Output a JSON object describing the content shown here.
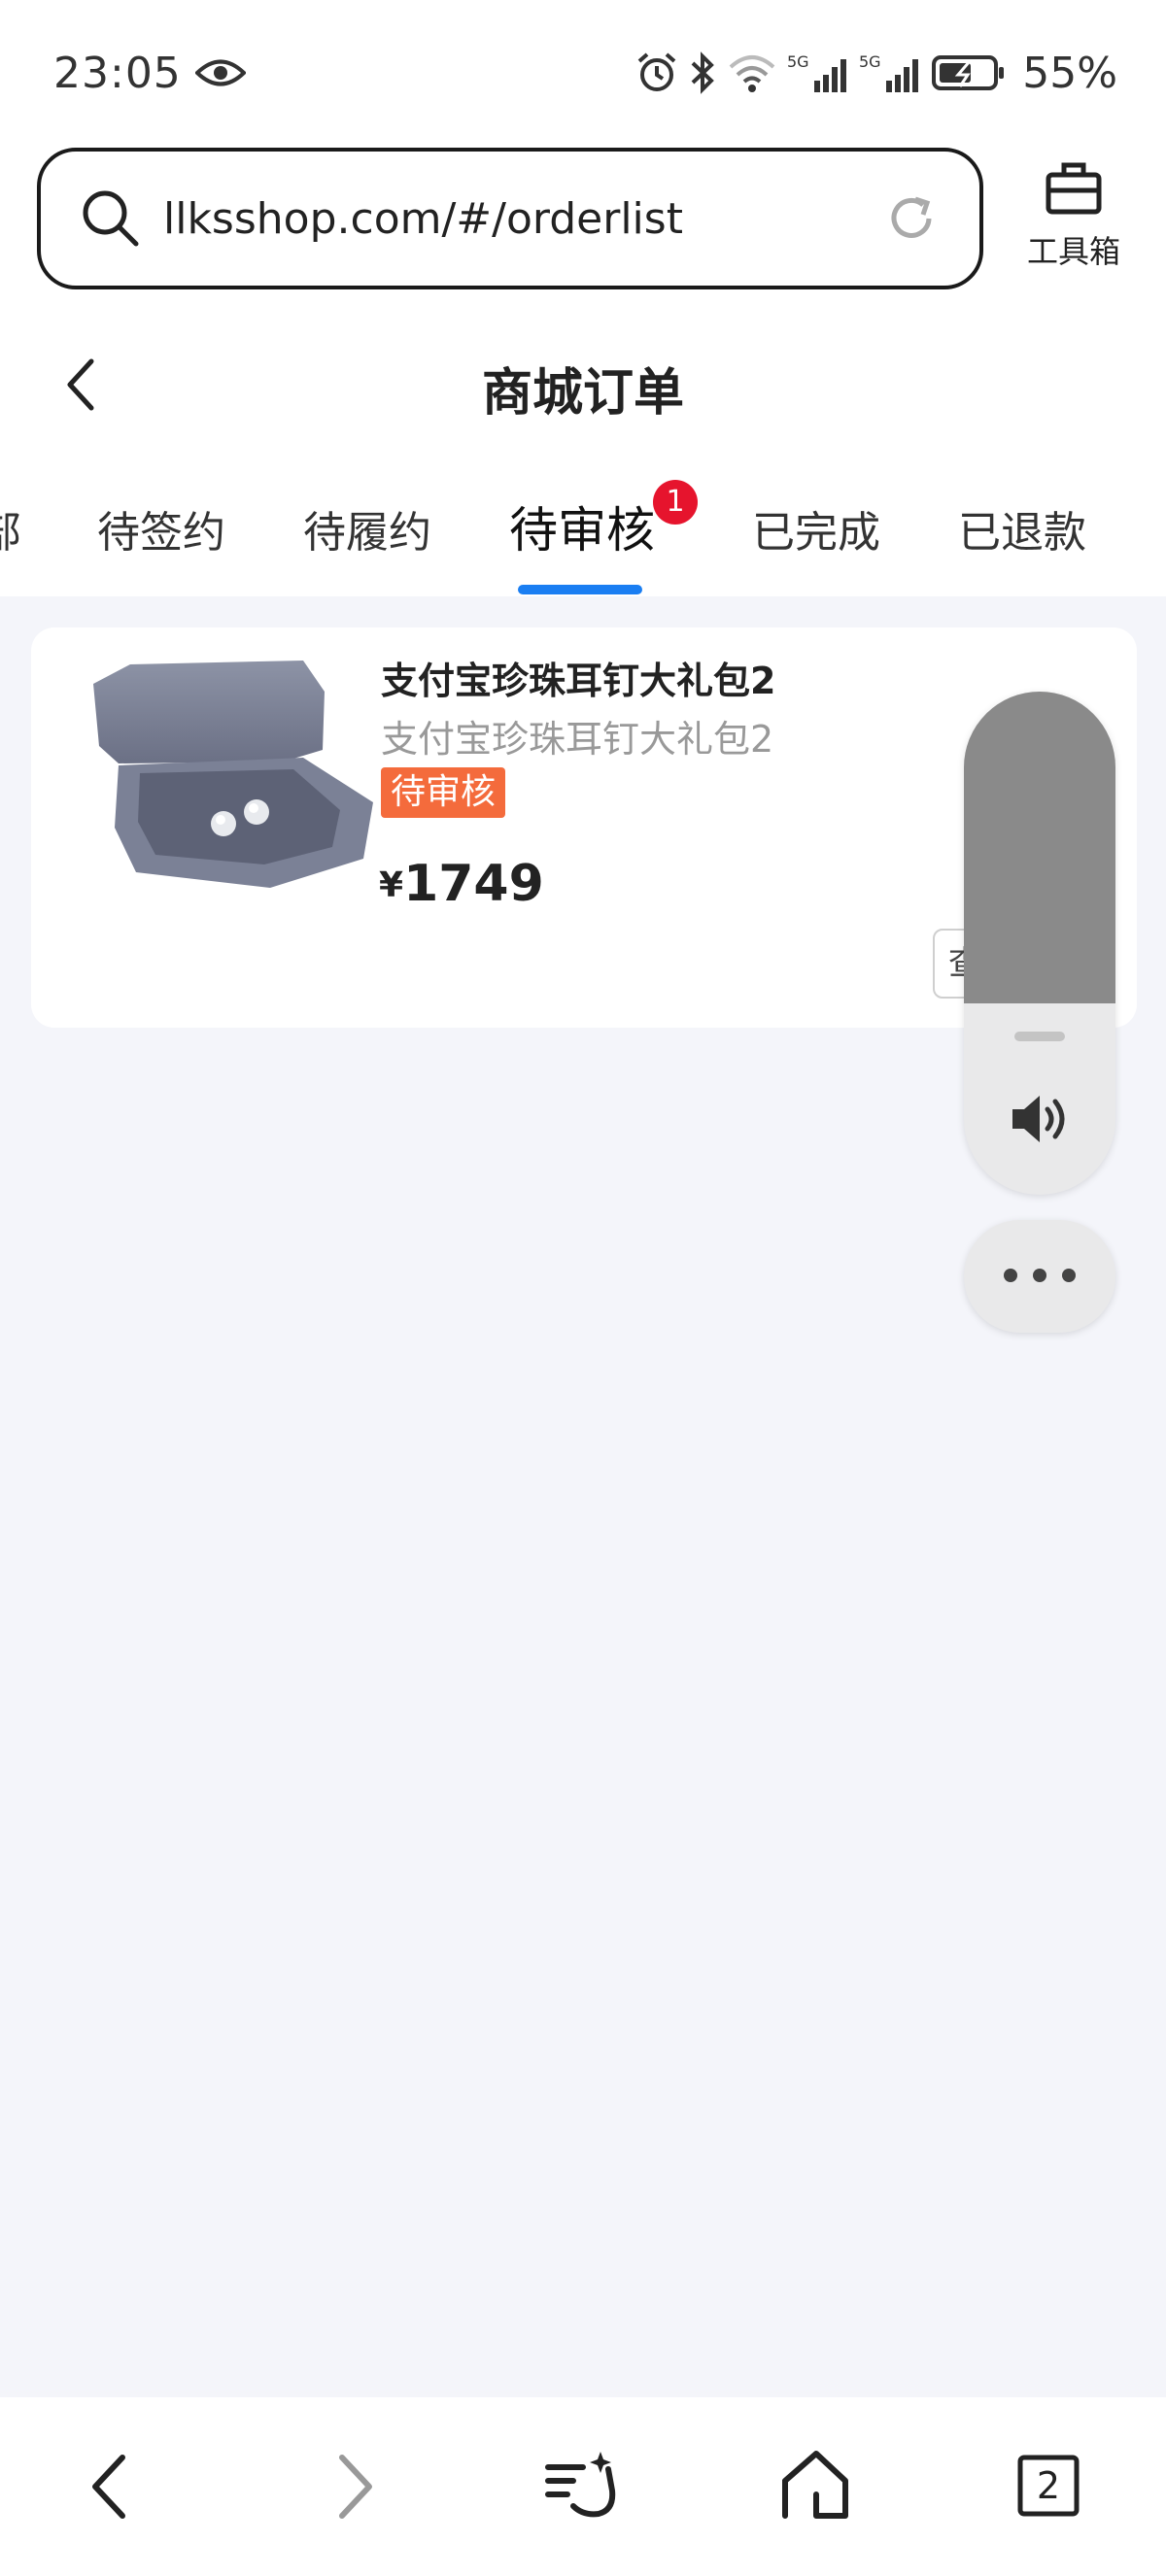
{
  "status_bar": {
    "time": "23:05",
    "battery": "55%",
    "network_labels": [
      "5G",
      "5G"
    ]
  },
  "browser": {
    "url": "llksshop.com/#/orderlist",
    "toolbox_label": "工具箱",
    "tab_count": "2"
  },
  "header": {
    "title": "商城订单"
  },
  "tabs": [
    {
      "label": "部"
    },
    {
      "label": "待签约"
    },
    {
      "label": "待履约"
    },
    {
      "label": "待审核",
      "active": true,
      "badge": "1"
    },
    {
      "label": "已完成"
    },
    {
      "label": "已退款"
    }
  ],
  "order": {
    "product_name": "支付宝珍珠耳钉大礼包2",
    "product_subtitle": "支付宝珍珠耳钉大礼包2",
    "status": "待审核",
    "currency_symbol": "¥",
    "price": "1749",
    "action_label": "查"
  },
  "volume_widget": {
    "level": 0.62
  },
  "colors": {
    "accent": "#1a7ef2",
    "badge": "#e6142d",
    "status_tag": "#f46b3c",
    "background": "#f4f5fa"
  }
}
